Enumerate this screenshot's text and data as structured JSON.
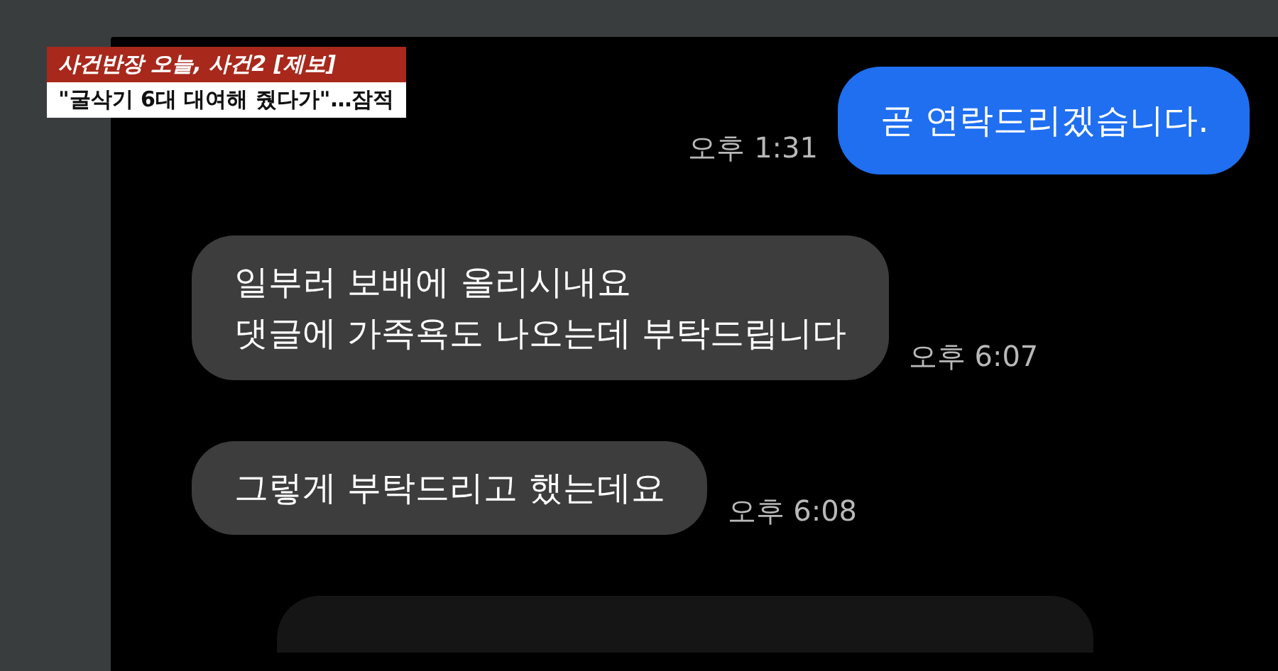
{
  "caption": {
    "category": "사건반장 오늘, 사건2 [제보]",
    "headline": "\"굴삭기 6대 대여해 줬다가\"…잠적"
  },
  "messages": [
    {
      "kind": "outgoing",
      "lines": [
        "곧 연락드리겠습니다."
      ],
      "time": "오후 1:31"
    },
    {
      "kind": "incoming",
      "lines": [
        "일부러 보배에 올리시내요",
        "댓글에 가족욕도 나오는데 부탁드립니다"
      ],
      "time": "오후 6:07"
    },
    {
      "kind": "incoming",
      "lines": [
        "그렇게 부탁드리고 했는데요"
      ],
      "time": "오후 6:08"
    },
    {
      "kind": "cut-off"
    }
  ]
}
